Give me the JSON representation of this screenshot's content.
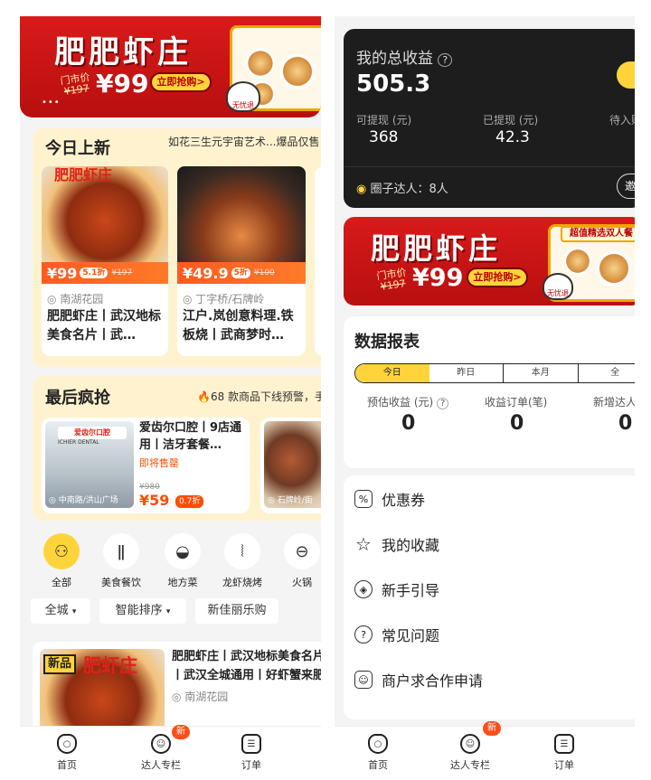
{
  "banner": {
    "title": "肥肥虾庄",
    "old_price_label": "门市价",
    "old_price": "¥197",
    "price": "¥99",
    "cta": "立即抢购>",
    "tag": "超值精选双人餐",
    "mascot_label": "无忧退",
    "dots": "•••"
  },
  "left": {
    "today": {
      "title": "今日上新",
      "marquee": "如花三生元宇宙艺术...爆品仅售",
      "items": [
        {
          "price": "¥99",
          "discount": "5.1折",
          "old": "¥197",
          "location": "南湖花园",
          "title": "肥肥虾庄丨武汉地标美食名片丨武…",
          "img_text": "肥肥虾庄"
        },
        {
          "price": "¥49.9",
          "discount": "5折",
          "old": "¥100",
          "location": "丁字桥/石牌岭",
          "title": "江户.岚创意料理.铁板烧丨武商梦时…",
          "img_text": ""
        }
      ]
    },
    "last": {
      "title": "最后疯抢",
      "alert": "68 款商品下线预警，手",
      "items": [
        {
          "brand": "爱齿尔口腔",
          "brand_en": "ICHIER DENTAL",
          "title": "爱齿尔口腔丨9店通用丨洁牙套餐…",
          "status": "即将售罄",
          "location": "中南路/洪山广场",
          "old": "¥980",
          "price": "¥59",
          "discount": "0.7折"
        },
        {
          "location": "石牌岭/街"
        }
      ]
    },
    "categories": [
      {
        "label": "全部",
        "icon": "all-icon",
        "glyph": "⚇"
      },
      {
        "label": "美食餐饮",
        "icon": "utensils-icon",
        "glyph": "ǁ"
      },
      {
        "label": "地方菜",
        "icon": "bowl-icon",
        "glyph": "◒"
      },
      {
        "label": "龙虾烧烤",
        "icon": "skewer-icon",
        "glyph": "⦚"
      },
      {
        "label": "火锅",
        "icon": "hotpot-icon",
        "glyph": "⊖"
      }
    ],
    "filters": [
      "全城",
      "智能排序",
      "新佳丽乐购"
    ],
    "filter_arrow": "▾",
    "feed": {
      "tag": "新品",
      "img_text": "肥虾庄",
      "title": "肥肥虾庄丨武汉地标美食名片丨武汉全城通用丨好虾蟹来肥",
      "location": "南湖花园"
    }
  },
  "nav": {
    "items": [
      {
        "label": "首页",
        "icon": "home-icon"
      },
      {
        "label": "达人专栏",
        "icon": "expert-icon"
      },
      {
        "label": "订单",
        "icon": "order-icon"
      }
    ],
    "badge": "新"
  },
  "right": {
    "earn": {
      "title": "我的总收益",
      "total": "505.3",
      "withdrawable_label": "可提现 (元)",
      "withdrawable": "368",
      "withdrawn_label": "已提现 (元)",
      "withdrawn": "42.3",
      "pending_label": "待入账",
      "circle_label": "圈子达人：",
      "circle_count": "8人",
      "invite_label": "邀"
    },
    "report": {
      "title": "数据报表",
      "tabs": [
        "今日",
        "昨日",
        "本月",
        "全"
      ],
      "metrics": [
        {
          "label": "预估收益 (元)",
          "value": "0"
        },
        {
          "label": "收益订单(笔)",
          "value": "0"
        },
        {
          "label": "新增达人",
          "value": "0"
        }
      ]
    },
    "menu": [
      {
        "label": "优惠券",
        "icon": "coupon-icon",
        "glyph": "%"
      },
      {
        "label": "我的收藏",
        "icon": "star-icon",
        "glyph": "☆"
      },
      {
        "label": "新手引导",
        "icon": "compass-icon",
        "glyph": "◈"
      },
      {
        "label": "常见问题",
        "icon": "question-icon",
        "glyph": "?"
      },
      {
        "label": "商户求合作申请",
        "icon": "merchant-icon",
        "glyph": "☺"
      }
    ]
  },
  "colors": {
    "accent": "#ffd43b",
    "brand_red": "#d81a1a",
    "price_orange": "#ff5a1f",
    "dark_card": "#1d1d1d"
  }
}
